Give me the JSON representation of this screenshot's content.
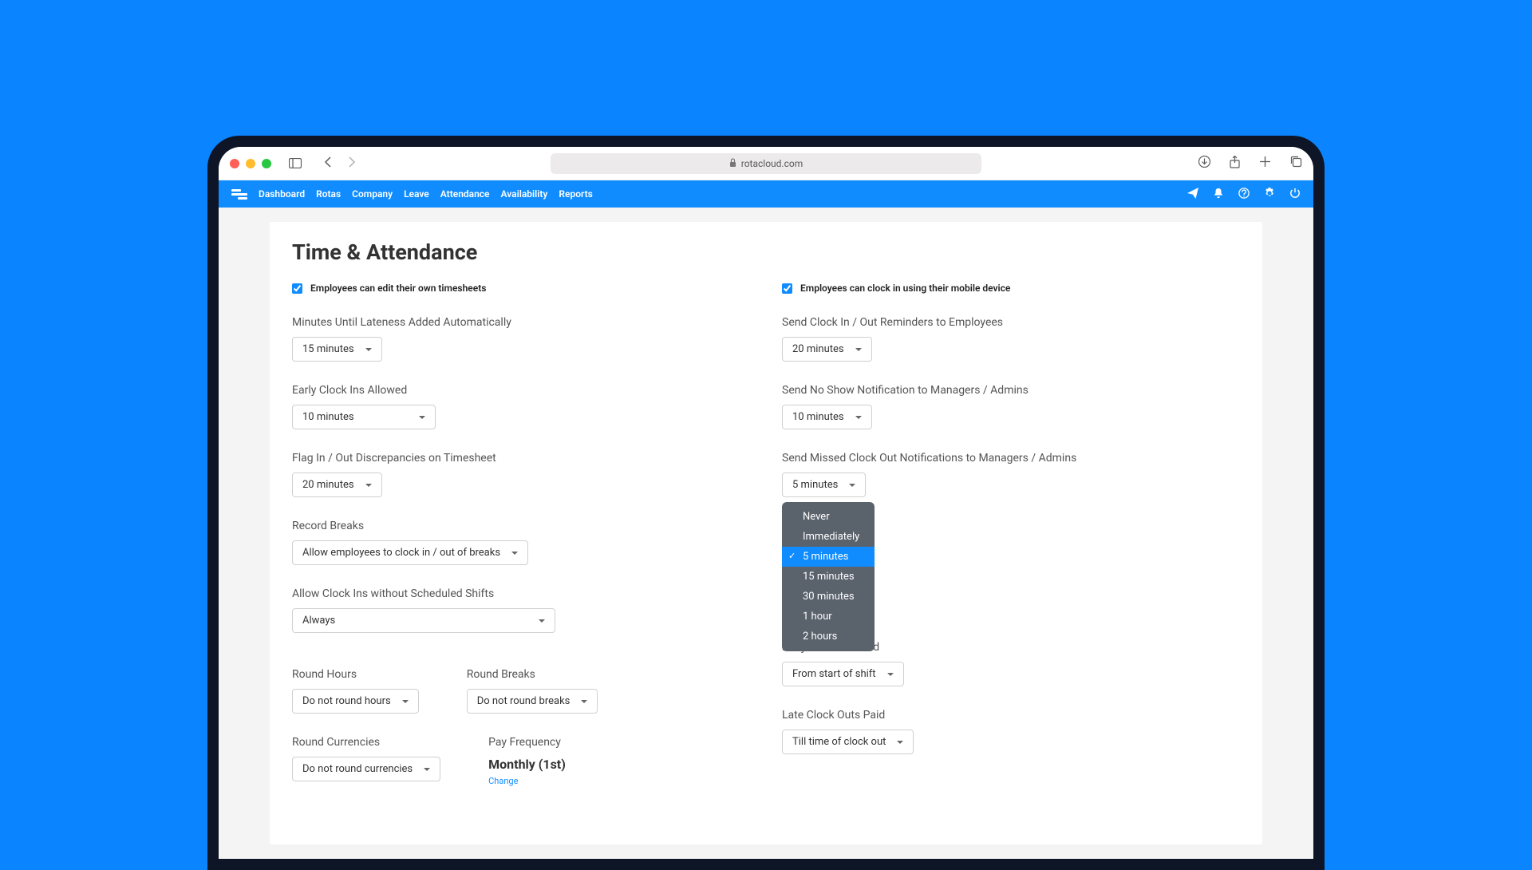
{
  "browser": {
    "url": "rotacloud.com"
  },
  "nav": {
    "items": [
      "Dashboard",
      "Rotas",
      "Company",
      "Leave",
      "Attendance",
      "Availability",
      "Reports"
    ]
  },
  "page": {
    "title": "Time & Attendance"
  },
  "left": {
    "checkbox_label": "Employees can edit their own timesheets",
    "fields": {
      "lateness": {
        "label": "Minutes Until Lateness Added Automatically",
        "value": "15 minutes"
      },
      "early_clock": {
        "label": "Early Clock Ins Allowed",
        "value": "10 minutes"
      },
      "flag_disc": {
        "label": "Flag In / Out Discrepancies on Timesheet",
        "value": "20 minutes"
      },
      "record_breaks": {
        "label": "Record Breaks",
        "value": "Allow employees to clock in / out of breaks"
      },
      "allow_unscheduled": {
        "label": "Allow Clock Ins without Scheduled Shifts",
        "value": "Always"
      },
      "round_hours": {
        "label": "Round Hours",
        "value": "Do not round hours"
      },
      "round_breaks": {
        "label": "Round Breaks",
        "value": "Do not round breaks"
      },
      "round_currencies": {
        "label": "Round Currencies",
        "value": "Do not round currencies"
      },
      "pay_freq": {
        "label": "Pay Frequency",
        "value": "Monthly (1st)",
        "change": "Change"
      }
    }
  },
  "right": {
    "checkbox_label": "Employees can clock in using their mobile device",
    "fields": {
      "reminders": {
        "label": "Send Clock In / Out Reminders to Employees",
        "value": "20 minutes"
      },
      "no_show": {
        "label": "Send No Show Notification to Managers / Admins",
        "value": "10 minutes"
      },
      "missed_out": {
        "label": "Send Missed Clock Out Notifications to Managers / Admins",
        "value": "5 minutes"
      },
      "early_paid": {
        "label": "Early Clock Ins Paid",
        "value": "From start of shift"
      },
      "late_paid": {
        "label": "Late Clock Outs Paid",
        "value": "Till time of clock out"
      }
    },
    "dropdown_options": [
      "Never",
      "Immediately",
      "5 minutes",
      "15 minutes",
      "30 minutes",
      "1 hour",
      "2 hours"
    ],
    "dropdown_selected": "5 minutes"
  }
}
